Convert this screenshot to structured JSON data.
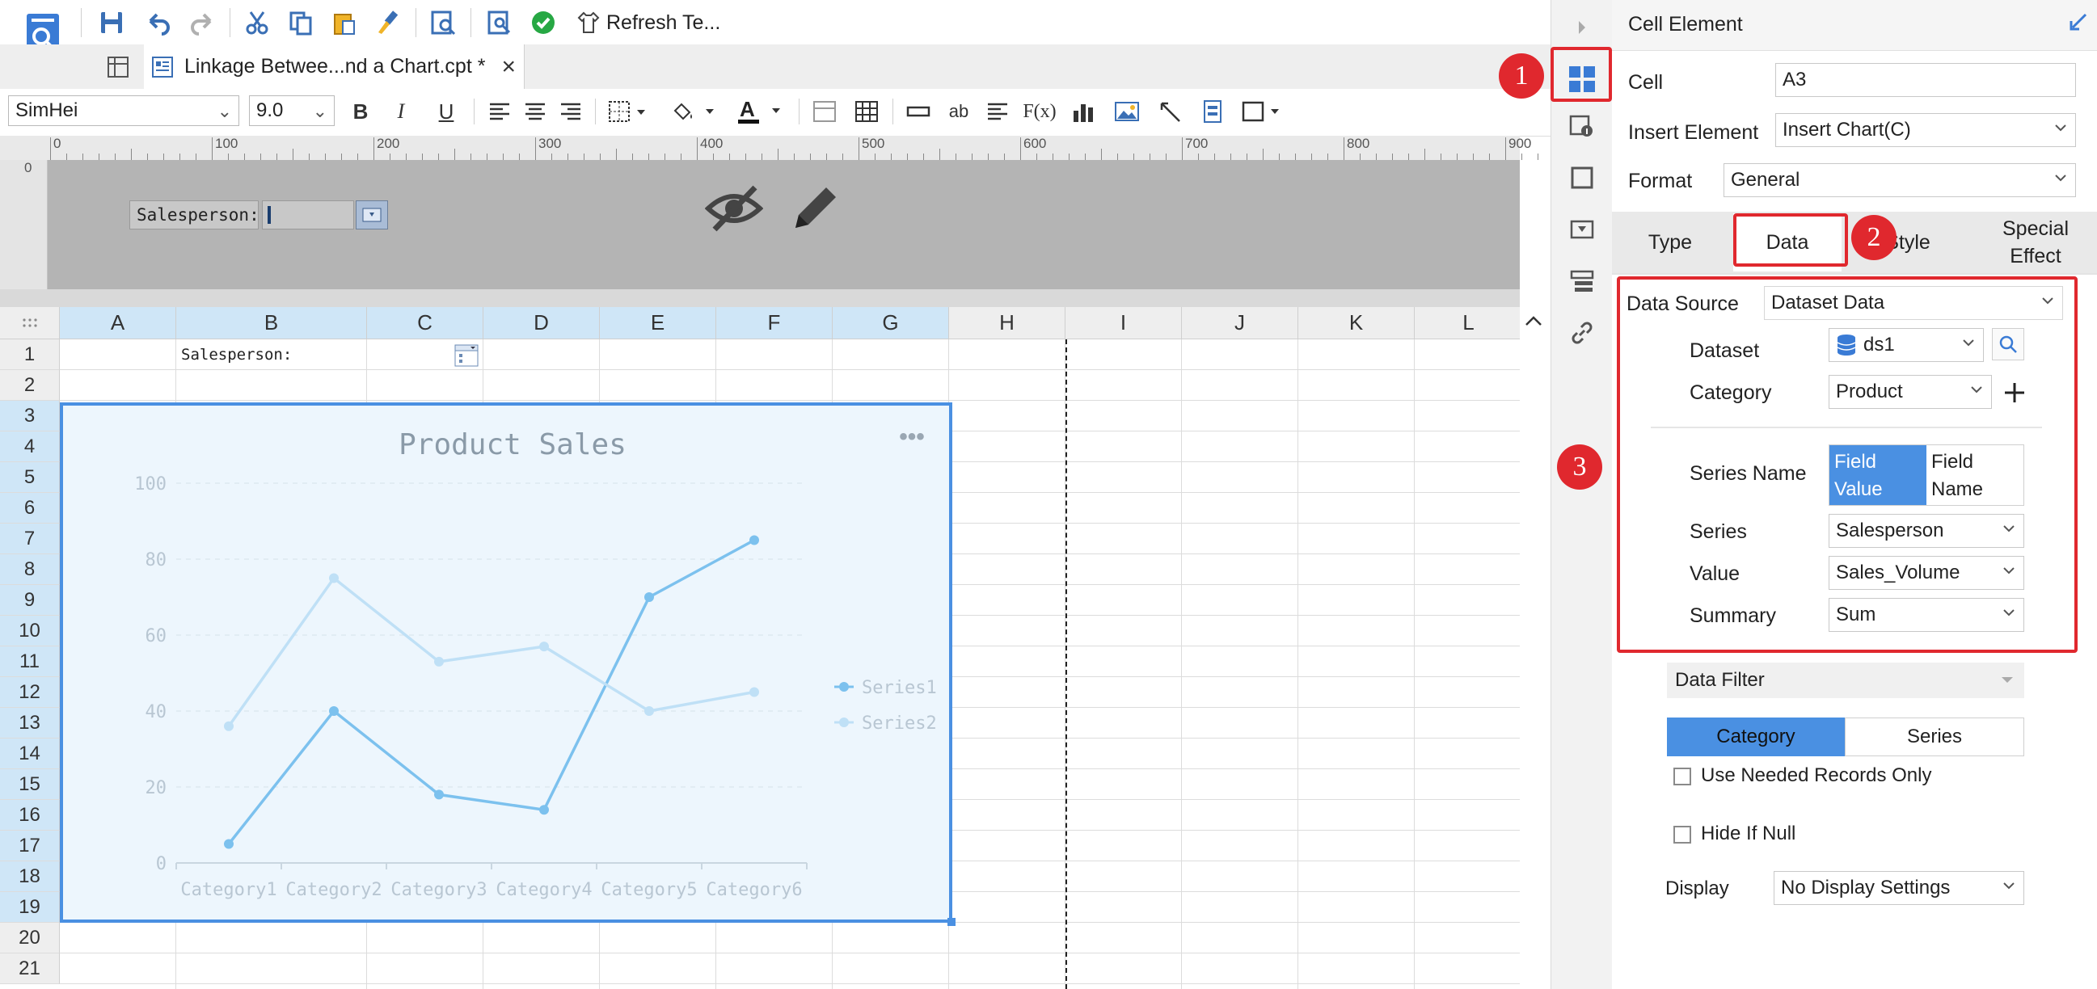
{
  "toolbar": {
    "refresh_label": "Refresh Te..."
  },
  "tab": {
    "title": "Linkage Betwee...nd a Chart.cpt *",
    "close": "×"
  },
  "format": {
    "font": "SimHei",
    "size": "9.0",
    "bold": "B",
    "italic": "I",
    "underline": "U"
  },
  "ruler": {
    "ticks": [
      "0",
      "100",
      "200",
      "300",
      "400",
      "500",
      "600",
      "700",
      "800",
      "900"
    ],
    "vtick": "0"
  },
  "param": {
    "label": "Salesperson:"
  },
  "grid": {
    "columns": [
      "A",
      "B",
      "C",
      "D",
      "E",
      "F",
      "G",
      "H",
      "I",
      "J",
      "K",
      "L"
    ],
    "rows": [
      "1",
      "2",
      "3",
      "4",
      "5",
      "6",
      "7",
      "8",
      "9",
      "10",
      "11",
      "12",
      "13",
      "14",
      "15",
      "16",
      "17",
      "18",
      "19",
      "20",
      "21"
    ],
    "b1": "Salesperson:"
  },
  "chart_data": {
    "type": "line",
    "title": "Product Sales",
    "categories": [
      "Category1",
      "Category2",
      "Category3",
      "Category4",
      "Category5",
      "Category6"
    ],
    "series": [
      {
        "name": "Series1",
        "values": [
          5,
          40,
          18,
          14,
          70,
          85
        ],
        "color": "#7cc1ee"
      },
      {
        "name": "Series2",
        "values": [
          36,
          75,
          53,
          57,
          40,
          45
        ],
        "color": "#bfe0f6"
      }
    ],
    "ylim": [
      0,
      100
    ],
    "yticks": [
      "0",
      "20",
      "40",
      "60",
      "80",
      "100"
    ],
    "grid": true,
    "legend": "right"
  },
  "panel": {
    "header": "Cell Element",
    "cell_label": "Cell",
    "cell_value": "A3",
    "insert_label": "Insert Element",
    "insert_value": "Insert Chart(C)",
    "format_label": "Format",
    "format_value": "General",
    "tabs": {
      "type": "Type",
      "data": "Data",
      "style": "Style",
      "special_1": "Special",
      "special_2": "Effect"
    },
    "datasource_label": "Data Source",
    "datasource_value": "Dataset Data",
    "dataset_label": "Dataset",
    "dataset_value": "ds1",
    "category_label": "Category",
    "category_value": "Product",
    "series_name_label": "Series Name",
    "series_name_opt1_a": "Field",
    "series_name_opt1_b": "Value",
    "series_name_opt2_a": "Field",
    "series_name_opt2_b": "Name",
    "series_label": "Series",
    "series_value": "Salesperson",
    "value_label": "Value",
    "value_value": "Sales_Volume",
    "summary_label": "Summary",
    "summary_value": "Sum",
    "filter_label": "Data Filter",
    "filter_tab1": "Category",
    "filter_tab2": "Series",
    "use_needed": "Use Needed Records Only",
    "hide_null": "Hide If Null",
    "display_label": "Display",
    "display_value": "No Display Settings"
  },
  "badges": [
    "1",
    "2",
    "3"
  ],
  "colors": {
    "accent": "#4a90e2",
    "red": "#e0282e",
    "chart_bg": "#edf6fd"
  }
}
